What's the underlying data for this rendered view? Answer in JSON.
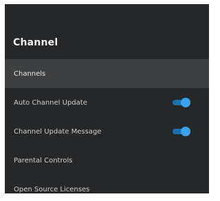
{
  "panel": {
    "title": "Channel"
  },
  "menu": {
    "items": [
      {
        "label": "Channels",
        "selected": true
      },
      {
        "label": "Auto Channel Update",
        "toggle": true,
        "on": true
      },
      {
        "label": "Channel Update Message",
        "toggle": true,
        "on": true
      },
      {
        "label": "Parental Controls"
      },
      {
        "label": "Open Source Licenses"
      }
    ]
  },
  "colors": {
    "panel_background": "#262728",
    "selected_row": "#3f4041",
    "toggle_accent": "#3aa3f0"
  }
}
